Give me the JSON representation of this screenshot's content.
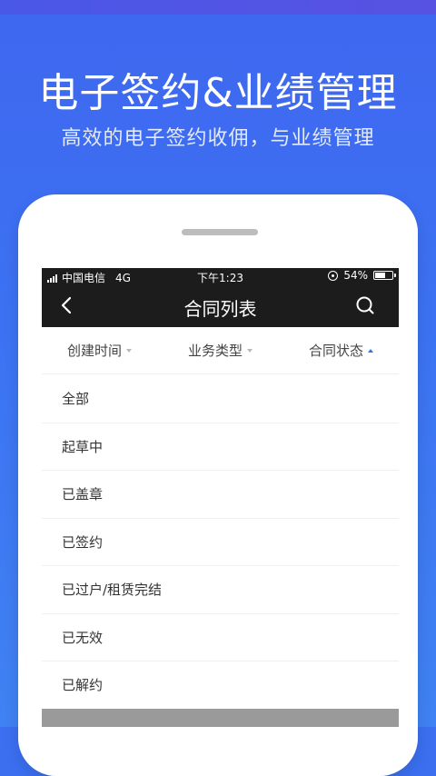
{
  "hero": {
    "title": "电子签约&业绩管理",
    "subtitle": "高效的电子签约收佣，与业绩管理"
  },
  "status_bar": {
    "carrier": "中国电信",
    "network": "4G",
    "time": "下午1:23",
    "battery": "54%"
  },
  "nav": {
    "title": "合同列表",
    "back_icon": "chevron-left-icon",
    "search_icon": "search-icon"
  },
  "filters": [
    {
      "label": "创建时间",
      "arrow": "down"
    },
    {
      "label": "业务类型",
      "arrow": "down"
    },
    {
      "label": "合同状态",
      "arrow": "up",
      "active": true
    }
  ],
  "status_options": [
    "全部",
    "起草中",
    "已盖章",
    "已签约",
    "已过户/租赁完结",
    "已无效",
    "已解约"
  ],
  "colors": {
    "background": "#3f6ff1",
    "navbar": "#1c1c1c",
    "active_arrow": "#2a7be5"
  }
}
